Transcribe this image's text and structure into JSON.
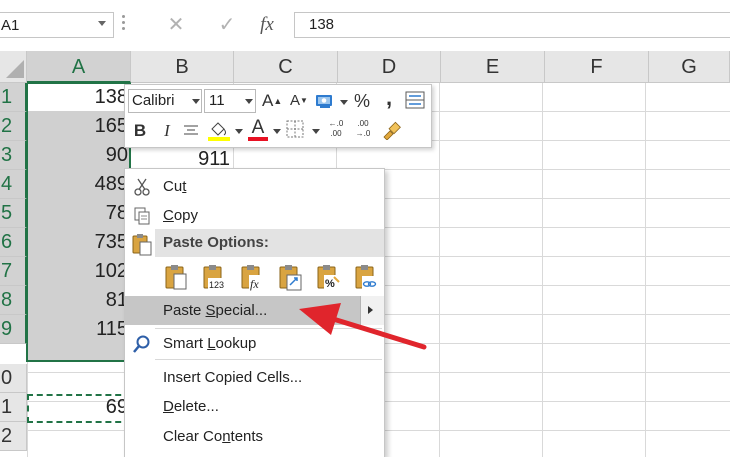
{
  "formula_bar": {
    "name_box": "A1",
    "cancel_glyph": "✕",
    "enter_glyph": "✓",
    "fx_label": "fx",
    "value": "138"
  },
  "columns": [
    "A",
    "B",
    "C",
    "D",
    "E",
    "F",
    "G"
  ],
  "rows": [
    "1",
    "2",
    "3",
    "4",
    "5",
    "6",
    "7",
    "8",
    "9",
    "0",
    "1",
    "2"
  ],
  "cells": {
    "a": [
      "138",
      "165",
      "90",
      "489",
      "78",
      "735",
      "102",
      "81",
      "115",
      "",
      "69",
      ""
    ],
    "b3": "911"
  },
  "mini_toolbar": {
    "font_name": "Calibri",
    "font_size": "11",
    "grow_font": "A",
    "shrink_font": "A",
    "percent": "%",
    "comma": ",",
    "bold": "B",
    "italic": "I",
    "font_color_letter": "A",
    "inc_decimal_top": "←.0",
    "inc_decimal_bot": ".00",
    "dec_decimal_top": ".00",
    "dec_decimal_bot": "→.0",
    "highlight_color": "#ffff00",
    "font_color": "#e81123"
  },
  "context_menu": {
    "cut_pre": "Cu",
    "cut_u": "t",
    "copy_pre": "",
    "copy_u": "C",
    "copy_post": "opy",
    "paste_options": "Paste Options:",
    "paste_special_pre": "Paste ",
    "paste_special_u": "S",
    "paste_special_post": "pecial...",
    "smart_lookup_pre": "Smart ",
    "smart_lookup_u": "L",
    "smart_lookup_post": "ookup",
    "insert_copied": "Insert Copied Cells...",
    "delete_pre": "",
    "delete_u": "D",
    "delete_post": "elete...",
    "clear_pre": "Clear Co",
    "clear_u": "n",
    "clear_post": "tents"
  },
  "annotation": {
    "arrow_color": "#e0252c"
  },
  "theme": {
    "excel_green": "#217346",
    "selection_gray": "#d0d0d0"
  }
}
